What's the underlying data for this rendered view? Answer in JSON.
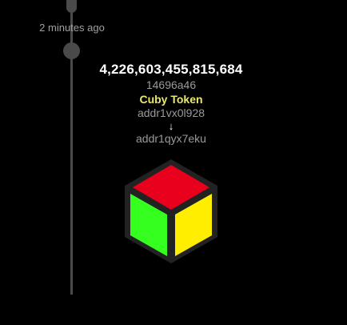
{
  "timeline": {
    "timestamp": "2 minutes ago"
  },
  "transaction": {
    "amount": "4,226,603,455,815,684",
    "tx_hash": "14696a46",
    "token_name": "Cuby Token",
    "from_address": "addr1vx0l928",
    "arrow": "↓",
    "to_address": "addr1qyx7eku"
  },
  "token_icon": {
    "name": "cube-icon",
    "colors": {
      "top": "#e8001c",
      "left": "#35ff1f",
      "right": "#ffee00",
      "outline": "#222222"
    }
  }
}
